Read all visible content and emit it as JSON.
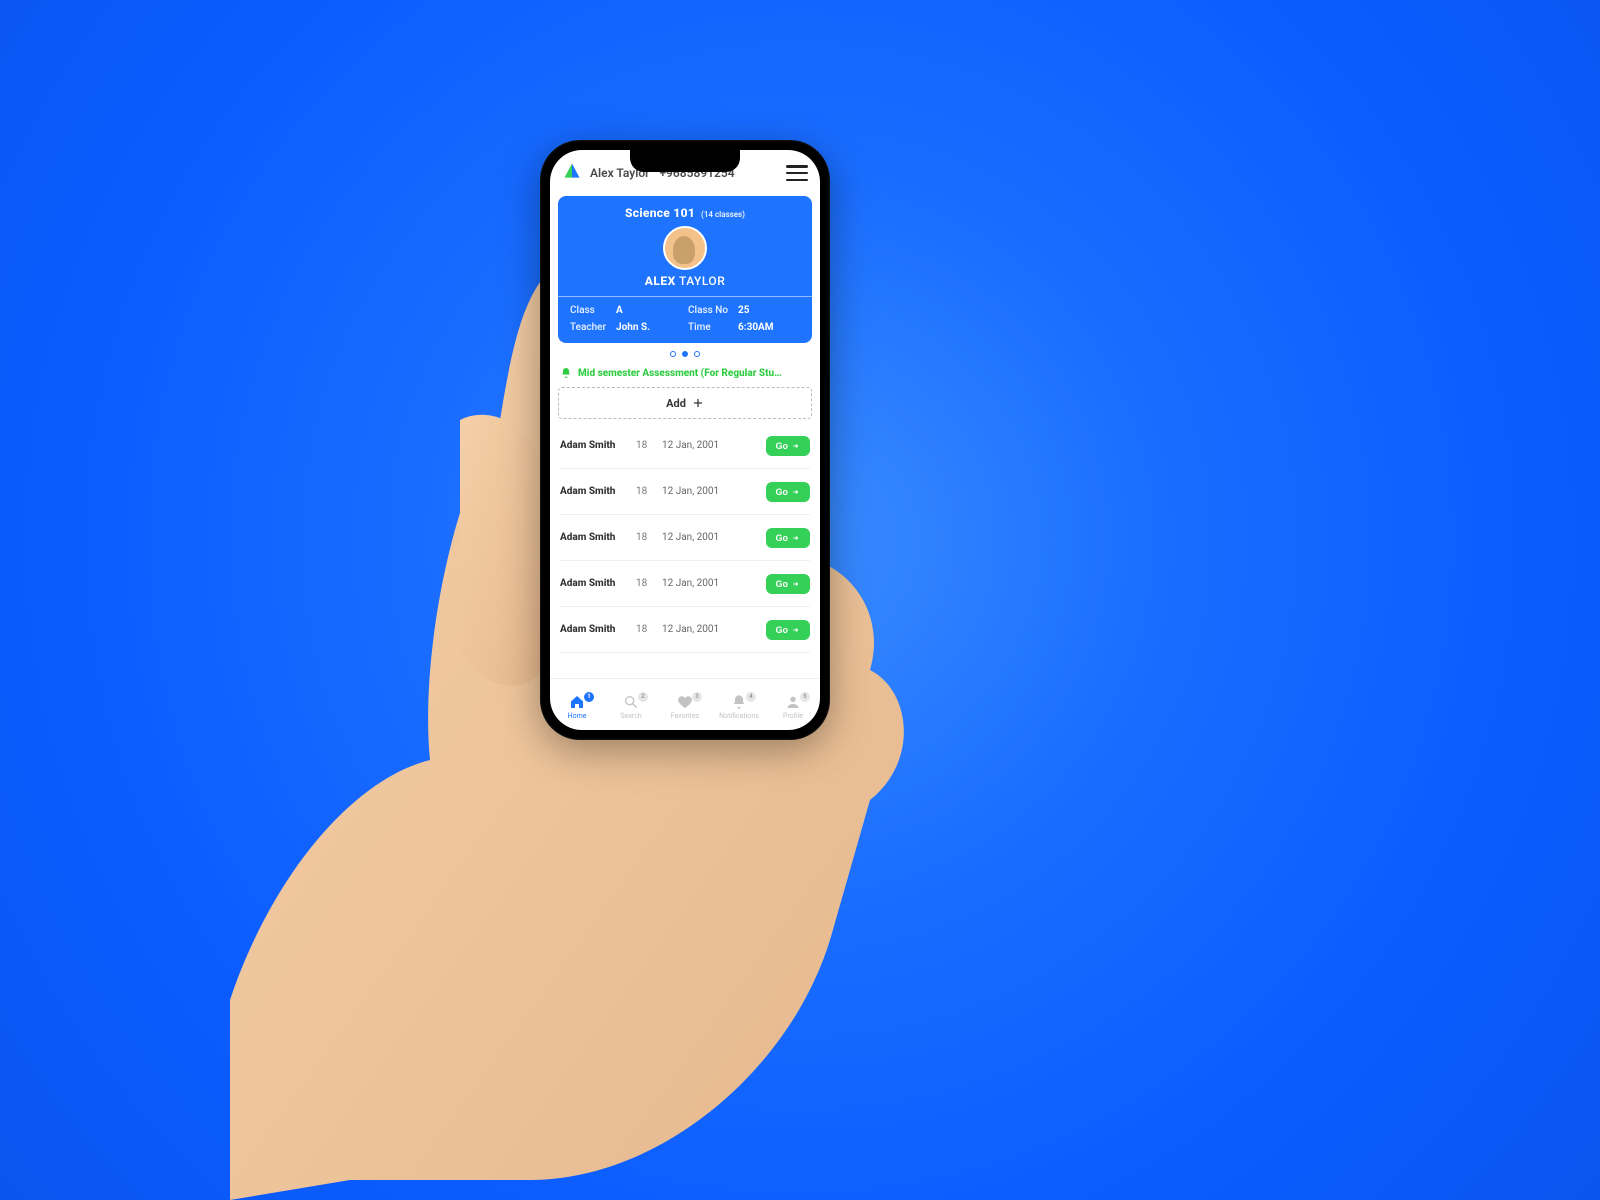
{
  "header": {
    "user_name": "Alex Taylor",
    "phone": "+9685891254"
  },
  "card": {
    "course": "Science 101",
    "classes_note": "(14 classes)",
    "name_first": "ALEX",
    "name_last": "TAYLOR",
    "rows": {
      "class_label": "Class",
      "class_value": "A",
      "classno_label": "Class No",
      "classno_value": "25",
      "teacher_label": "Teacher",
      "teacher_value": "John S.",
      "time_label": "Time",
      "time_value": "6:30AM"
    }
  },
  "pager": {
    "count": 3,
    "active": 1
  },
  "banner": "Mid semester Assessment (For Regular Stu…",
  "add_label": "Add",
  "students": [
    {
      "name": "Adam Smith",
      "age": "18",
      "dob": "12 Jan, 2001",
      "go": "Go"
    },
    {
      "name": "Adam Smith",
      "age": "18",
      "dob": "12 Jan, 2001",
      "go": "Go"
    },
    {
      "name": "Adam Smith",
      "age": "18",
      "dob": "12 Jan, 2001",
      "go": "Go"
    },
    {
      "name": "Adam Smith",
      "age": "18",
      "dob": "12 Jan, 2001",
      "go": "Go"
    },
    {
      "name": "Adam Smith",
      "age": "18",
      "dob": "12 Jan, 2001",
      "go": "Go"
    }
  ],
  "tabs": [
    {
      "label": "Home",
      "badge": "1"
    },
    {
      "label": "Search",
      "badge": "2"
    },
    {
      "label": "Favorites",
      "badge": "3"
    },
    {
      "label": "Notifications",
      "badge": "4"
    },
    {
      "label": "Profile",
      "badge": "5"
    }
  ],
  "colors": {
    "brand": "#1e74ff",
    "accent": "#34d058"
  }
}
